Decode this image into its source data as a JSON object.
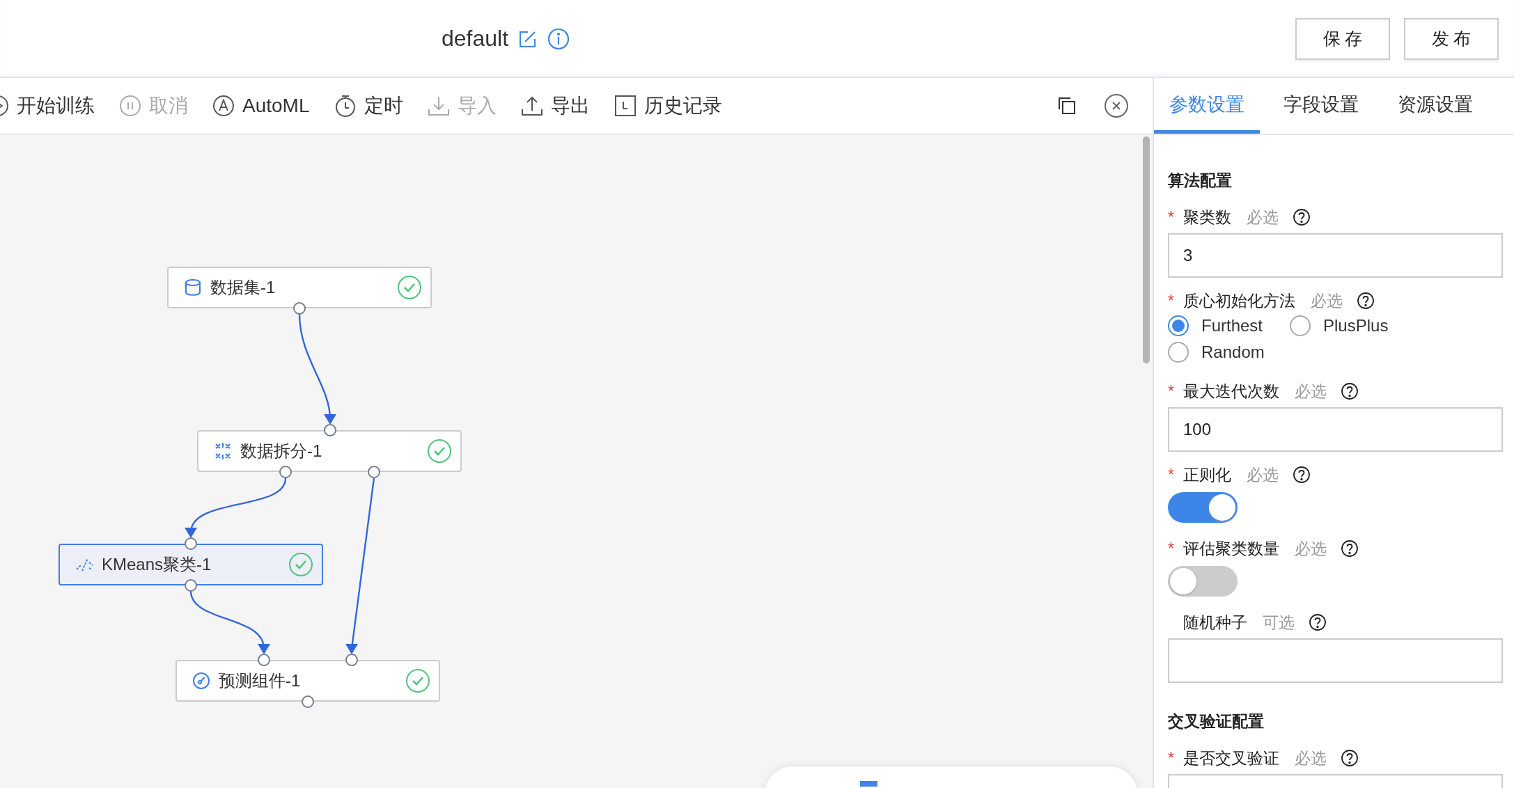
{
  "header": {
    "title": "default",
    "buttons": [
      "保 存",
      "发 布"
    ]
  },
  "toolbar": {
    "items": [
      {
        "kind": "start",
        "label": "开始训练",
        "disabled": false
      },
      {
        "kind": "pause",
        "label": "取消",
        "disabled": true
      },
      {
        "kind": "automl",
        "label": "AutoML",
        "disabled": false
      },
      {
        "kind": "timer",
        "label": "定时",
        "disabled": false
      },
      {
        "kind": "import",
        "label": "导入",
        "disabled": true
      },
      {
        "kind": "export",
        "label": "导出",
        "disabled": false
      },
      {
        "kind": "history",
        "label": "历史记录",
        "disabled": false
      }
    ]
  },
  "canvas": {
    "nodes": [
      {
        "kind": "dataset",
        "label": "数据集-1",
        "selected": false,
        "done": true
      },
      {
        "kind": "split",
        "label": "数据拆分-1",
        "selected": false,
        "done": true
      },
      {
        "kind": "cluster",
        "label": "KMeans聚类-1",
        "selected": true,
        "done": true
      },
      {
        "kind": "predict",
        "label": "预测组件-1",
        "selected": false,
        "done": true
      }
    ]
  },
  "panel": {
    "tabs": [
      {
        "label": "参数设置",
        "selected": true
      },
      {
        "label": "字段设置",
        "selected": false
      },
      {
        "label": "资源设置",
        "selected": false
      }
    ],
    "sections": [
      {
        "title": "算法配置",
        "fields": [
          {
            "kind": "input",
            "mark": "*",
            "label": "聚类数",
            "hint": "必选",
            "value": "3"
          },
          {
            "kind": "radio",
            "mark": "*",
            "label": "质心初始化方法",
            "hint": "必选",
            "options": [
              {
                "label": "Furthest",
                "selected": true
              },
              {
                "label": "PlusPlus",
                "selected": false
              },
              {
                "label": "Random",
                "selected": false
              }
            ]
          },
          {
            "kind": "input",
            "mark": "*",
            "label": "最大迭代次数",
            "hint": "必选",
            "value": "100"
          },
          {
            "kind": "switch",
            "mark": "*",
            "label": "正则化",
            "hint": "必选",
            "on": true
          },
          {
            "kind": "switch",
            "mark": "*",
            "label": "评估聚类数量",
            "hint": "必选",
            "on": false
          },
          {
            "kind": "input",
            "label": "随机种子",
            "hint": "可选"
          }
        ]
      },
      {
        "title": "交叉验证配置",
        "fields": [
          {
            "kind": "input",
            "mark": "*",
            "label": "是否交叉验证",
            "hint": "必选"
          }
        ]
      }
    ]
  }
}
